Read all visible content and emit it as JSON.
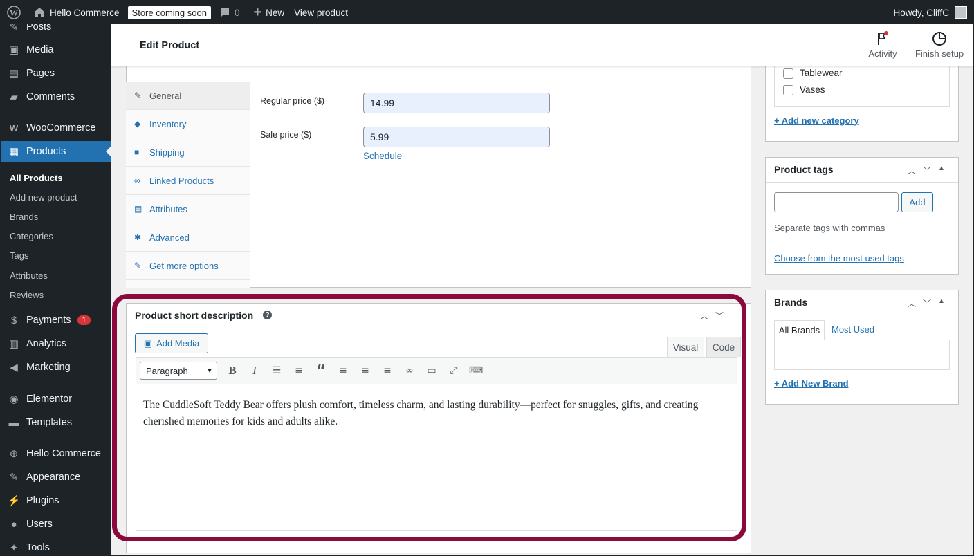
{
  "adminbar": {
    "site_name": "Hello Commerce",
    "store_badge": "Store coming soon",
    "comments_count": "0",
    "new_label": "New",
    "view_product": "View product",
    "howdy": "Howdy, CliffC"
  },
  "sidebar": {
    "posts": "Posts",
    "media": "Media",
    "pages": "Pages",
    "comments": "Comments",
    "woocommerce": "WooCommerce",
    "products": "Products",
    "submenu": [
      "All Products",
      "Add new product",
      "Brands",
      "Categories",
      "Tags",
      "Attributes",
      "Reviews"
    ],
    "payments": "Payments",
    "payments_badge": "1",
    "analytics": "Analytics",
    "marketing": "Marketing",
    "elementor": "Elementor",
    "templates": "Templates",
    "hello_commerce": "Hello Commerce",
    "appearance": "Appearance",
    "plugins": "Plugins",
    "users": "Users",
    "tools": "Tools"
  },
  "topbar": {
    "title": "Edit Product",
    "activity": "Activity",
    "finish_setup": "Finish setup"
  },
  "product_data": {
    "tabs": [
      "General",
      "Inventory",
      "Shipping",
      "Linked Products",
      "Attributes",
      "Advanced",
      "Get more options"
    ],
    "regular_price_label": "Regular price ($)",
    "regular_price": "14.99",
    "sale_price_label": "Sale price ($)",
    "sale_price": "5.99",
    "schedule": "Schedule"
  },
  "short_description": {
    "title": "Product short description",
    "add_media": "Add Media",
    "tab_visual": "Visual",
    "tab_code": "Code",
    "format": "Paragraph",
    "content": "The CuddleSoft Teddy Bear offers plush comfort, timeless charm, and lasting durability—perfect for snuggles, gifts, and creating cherished memories for kids and adults alike."
  },
  "categories": {
    "items": [
      "Tablewear",
      "Vases"
    ],
    "add_new": "+ Add new category"
  },
  "tags": {
    "title": "Product tags",
    "add_button": "Add",
    "hint": "Separate tags with commas",
    "choose": "Choose from the most used tags"
  },
  "brands": {
    "title": "Brands",
    "tab_all": "All Brands",
    "tab_most": "Most Used",
    "add_new": "+ Add New Brand"
  },
  "colors": {
    "admin_dark": "#1d2327",
    "accent": "#2271b1",
    "highlight": "#8c0a3b"
  }
}
